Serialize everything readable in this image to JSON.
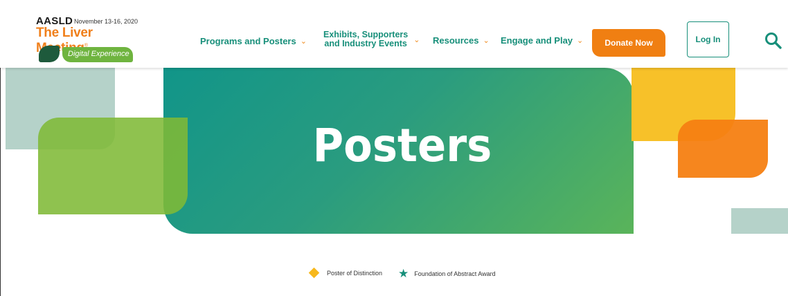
{
  "logo": {
    "org": "AASLD",
    "dates": "November 13-16, 2020",
    "meeting": "The Liver Meeting",
    "registered": "®",
    "subtitle": "Digital Experience"
  },
  "nav": {
    "programs": "Programs and Posters",
    "exhibits_line1": "Exhibits, Supporters",
    "exhibits_line2": "and Industry Events",
    "resources": "Resources",
    "engage": "Engage and Play",
    "chevron": "⌄"
  },
  "actions": {
    "donate": "Donate Now",
    "login": "Log In"
  },
  "hero": {
    "title": "Posters"
  },
  "legend": {
    "distinction": "Poster of Distinction",
    "foundation": "Foundation of Abstract Award"
  },
  "colors": {
    "brand_teal": "#178f7a",
    "brand_orange": "#f07f12",
    "brand_green": "#6fb43f",
    "yellow": "#f7c129"
  },
  "icons": {
    "search": "search-icon",
    "distinction": "diamond-icon",
    "foundation": "star-icon"
  }
}
